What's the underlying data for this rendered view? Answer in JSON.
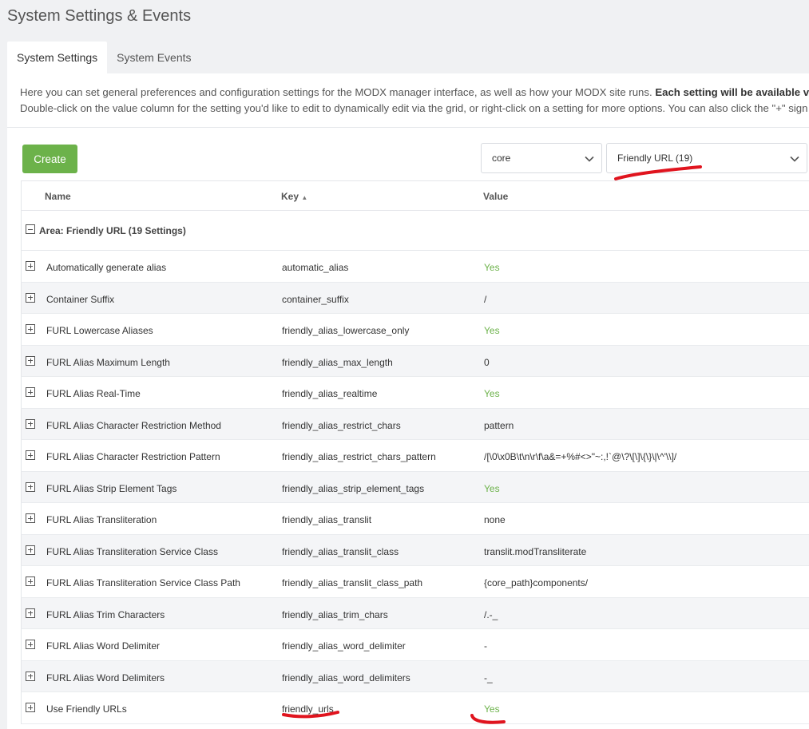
{
  "page": {
    "title": "System Settings & Events"
  },
  "tabs": [
    {
      "label": "System Settings",
      "active": true
    },
    {
      "label": "System Events",
      "active": false
    }
  ],
  "description": {
    "line1_prefix": "Here you can set general preferences and configuration settings for the MODX manager interface, as well as how your MODX site runs. ",
    "line1_bold": "Each setting will be available via th",
    "line2": "Double-click on the value column for the setting you'd like to edit to dynamically edit via the grid, or right-click on a setting for more options. You can also click the \"+\" sign"
  },
  "toolbar": {
    "create_label": "Create",
    "namespace_value": "core",
    "area_value": "Friendly URL (19)"
  },
  "grid": {
    "columns": {
      "name": "Name",
      "key": "Key",
      "value": "Value"
    },
    "sort_indicator": "▲",
    "group_label": "Area: Friendly URL (19 Settings)",
    "rows": [
      {
        "name": "Automatically generate alias",
        "key": "automatic_alias",
        "value": "Yes"
      },
      {
        "name": "Container Suffix",
        "key": "container_suffix",
        "value": "/"
      },
      {
        "name": "FURL Lowercase Aliases",
        "key": "friendly_alias_lowercase_only",
        "value": "Yes"
      },
      {
        "name": "FURL Alias Maximum Length",
        "key": "friendly_alias_max_length",
        "value": "0"
      },
      {
        "name": "FURL Alias Real-Time",
        "key": "friendly_alias_realtime",
        "value": "Yes"
      },
      {
        "name": "FURL Alias Character Restriction Method",
        "key": "friendly_alias_restrict_chars",
        "value": "pattern"
      },
      {
        "name": "FURL Alias Character Restriction Pattern",
        "key": "friendly_alias_restrict_chars_pattern",
        "value": "/[\\0\\x0B\\t\\n\\r\\f\\a&=+%#<>\"~:,!`@\\?\\[\\]\\{\\}\\|\\^'\\\\]/"
      },
      {
        "name": "FURL Alias Strip Element Tags",
        "key": "friendly_alias_strip_element_tags",
        "value": "Yes"
      },
      {
        "name": "FURL Alias Transliteration",
        "key": "friendly_alias_translit",
        "value": "none"
      },
      {
        "name": "FURL Alias Transliteration Service Class",
        "key": "friendly_alias_translit_class",
        "value": "translit.modTransliterate"
      },
      {
        "name": "FURL Alias Transliteration Service Class Path",
        "key": "friendly_alias_translit_class_path",
        "value": "{core_path}components/"
      },
      {
        "name": "FURL Alias Trim Characters",
        "key": "friendly_alias_trim_chars",
        "value": "/.-_"
      },
      {
        "name": "FURL Alias Word Delimiter",
        "key": "friendly_alias_word_delimiter",
        "value": "-"
      },
      {
        "name": "FURL Alias Word Delimiters",
        "key": "friendly_alias_word_delimiters",
        "value": "-_"
      },
      {
        "name": "Use Friendly URLs",
        "key": "friendly_urls",
        "value": "Yes"
      }
    ]
  },
  "colors": {
    "accent_green": "#6cb24a",
    "annotation_red": "#e0141e"
  }
}
